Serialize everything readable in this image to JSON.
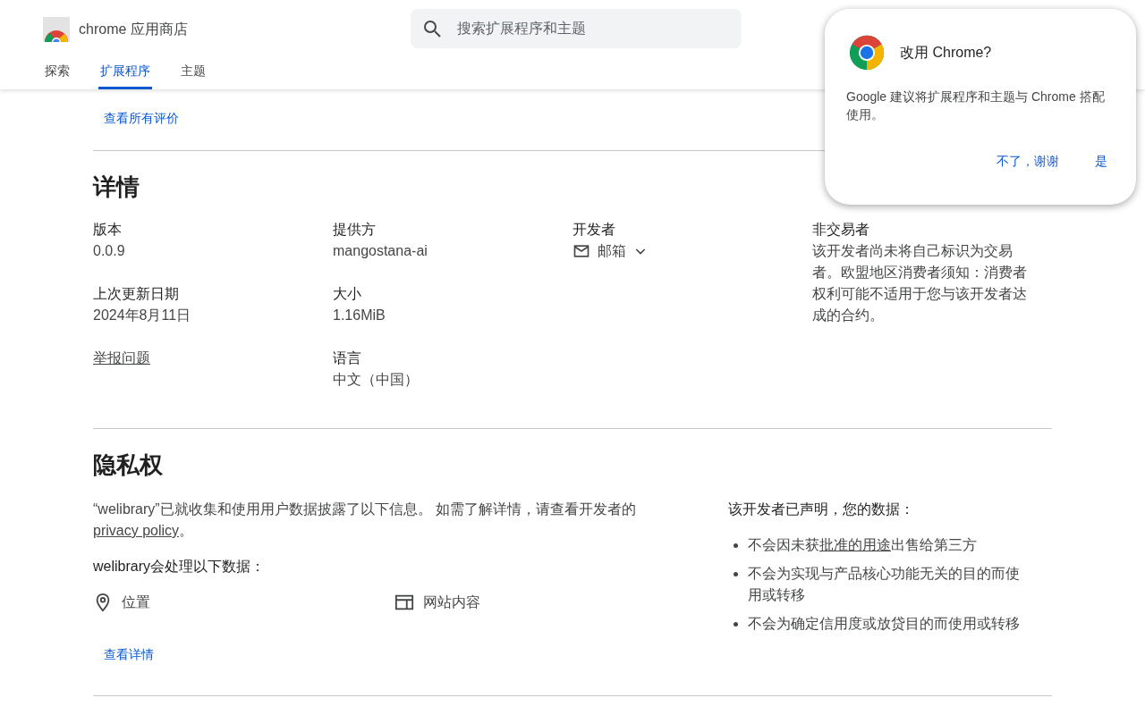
{
  "header": {
    "store_title": "chrome 应用商店",
    "search": {
      "placeholder": "搜索扩展程序和主题"
    },
    "tabs": [
      {
        "label": "探索",
        "selected": false
      },
      {
        "label": "扩展程序",
        "selected": true
      },
      {
        "label": "主题",
        "selected": false
      }
    ]
  },
  "reviews_link": "查看所有评价",
  "details": {
    "title": "详情",
    "columns": [
      [
        {
          "kind": "field",
          "label": "版本",
          "value": "0.0.9"
        },
        {
          "kind": "field",
          "label": "上次更新日期",
          "value": "2024年8月11日"
        },
        {
          "kind": "link",
          "label": "举报问题"
        }
      ],
      [
        {
          "kind": "field",
          "label": "提供方",
          "value": "mangostana-ai"
        },
        {
          "kind": "field",
          "label": "大小",
          "value": "1.16MiB"
        },
        {
          "kind": "field",
          "label": "语言",
          "value": "中文（中国）"
        }
      ],
      [
        {
          "kind": "email",
          "label": "开发者",
          "value": "邮箱"
        }
      ],
      [
        {
          "kind": "field",
          "label": "非交易者",
          "value": "该开发者尚未将自己标识为交易者。欧盟地区消费者须知：消费者权利可能不适用于您与该开发者达成的合约。"
        }
      ]
    ]
  },
  "privacy": {
    "title": "隐私权",
    "intro": {
      "text": "“welibrary”已就收集和使用用户数据披露了以下信息。 如需了解详情，请查看开发者的",
      "link": "privacy policy",
      "after": "。"
    },
    "handles_title": "welibrary会处理以下数据：",
    "data_types": [
      {
        "kind": "location",
        "label": "位置"
      },
      {
        "kind": "web",
        "label": "网站内容"
      }
    ],
    "details_link": "查看详情",
    "declaration_title": "该开发者已声明，您的数据：",
    "declarations": [
      {
        "before": "不会因未获",
        "link": "批准的用途",
        "after": "出售给第三方"
      },
      {
        "before": "不会为实现与产品核心功能无关的目的而使用或转移"
      },
      {
        "before": "不会为确定信用度或放贷目的而使用或转移"
      }
    ]
  },
  "popup": {
    "title": "改用 Chrome?",
    "message": "Google 建议将扩展程序和主题与 Chrome 搭配使用。",
    "buttons": [
      "不了，谢谢",
      "是"
    ]
  }
}
